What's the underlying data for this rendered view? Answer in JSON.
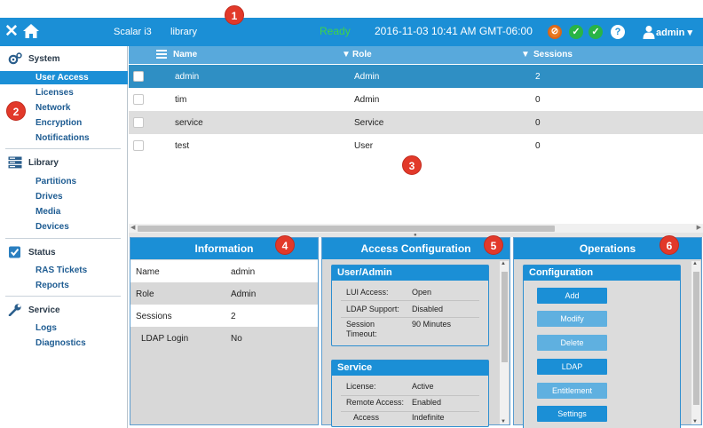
{
  "callouts": [
    "1",
    "2",
    "3",
    "4",
    "5",
    "6"
  ],
  "topbar": {
    "product": "Scalar i3",
    "library": "library",
    "status": "Ready",
    "datetime": "2016-11-03 10:41 AM GMT-06:00",
    "help": "?",
    "user": "admin",
    "icons": [
      "close-icon",
      "home-icon",
      "warning-icon",
      "check-icon",
      "check-icon",
      "help-icon",
      "user-icon"
    ]
  },
  "sidebar": {
    "sections": [
      {
        "label": "System",
        "icon": "gears-icon",
        "items": [
          "User Access",
          "Licenses",
          "Network",
          "Encryption",
          "Notifications"
        ]
      },
      {
        "label": "Library",
        "icon": "library-icon",
        "items": [
          "Partitions",
          "Drives",
          "Media",
          "Devices"
        ]
      },
      {
        "label": "Status",
        "icon": "checkbox-icon",
        "items": [
          "RAS Tickets",
          "Reports"
        ]
      },
      {
        "label": "Service",
        "icon": "wrench-icon",
        "items": [
          "Logs",
          "Diagnostics"
        ]
      }
    ],
    "active": "User Access"
  },
  "table": {
    "columns": [
      "Name",
      "Role",
      "Sessions"
    ],
    "rows": [
      {
        "name": "admin",
        "role": "Admin",
        "sessions": "2"
      },
      {
        "name": "tim",
        "role": "Admin",
        "sessions": "0"
      },
      {
        "name": "service",
        "role": "Service",
        "sessions": "0"
      },
      {
        "name": "test",
        "role": "User",
        "sessions": "0"
      }
    ]
  },
  "information": {
    "title": "Information",
    "rows": [
      {
        "k": "Name",
        "v": "admin"
      },
      {
        "k": "Role",
        "v": "Admin"
      },
      {
        "k": "Sessions",
        "v": "2"
      },
      {
        "k": "LDAP Login",
        "v": "No"
      }
    ]
  },
  "access": {
    "title": "Access Configuration",
    "user_admin": {
      "title": "User/Admin",
      "rows": [
        {
          "k": "LUI Access:",
          "v": "Open"
        },
        {
          "k": "LDAP Support:",
          "v": "Disabled"
        },
        {
          "k": "Session Timeout:",
          "v": "90 Minutes"
        }
      ]
    },
    "service": {
      "title": "Service",
      "rows": [
        {
          "k": "License:",
          "v": "Active"
        },
        {
          "k": "Remote Access:",
          "v": "Enabled"
        },
        {
          "k": "Access",
          "v": "Indefinite"
        }
      ]
    }
  },
  "operations": {
    "title": "Operations",
    "config_title": "Configuration",
    "buttons": [
      {
        "label": "Add",
        "enabled": true
      },
      {
        "label": "Modify",
        "enabled": false
      },
      {
        "label": "Delete",
        "enabled": false
      },
      {
        "label": "LDAP",
        "enabled": true
      },
      {
        "label": "Entitlement",
        "enabled": false
      },
      {
        "label": "Settings",
        "enabled": true
      }
    ]
  }
}
